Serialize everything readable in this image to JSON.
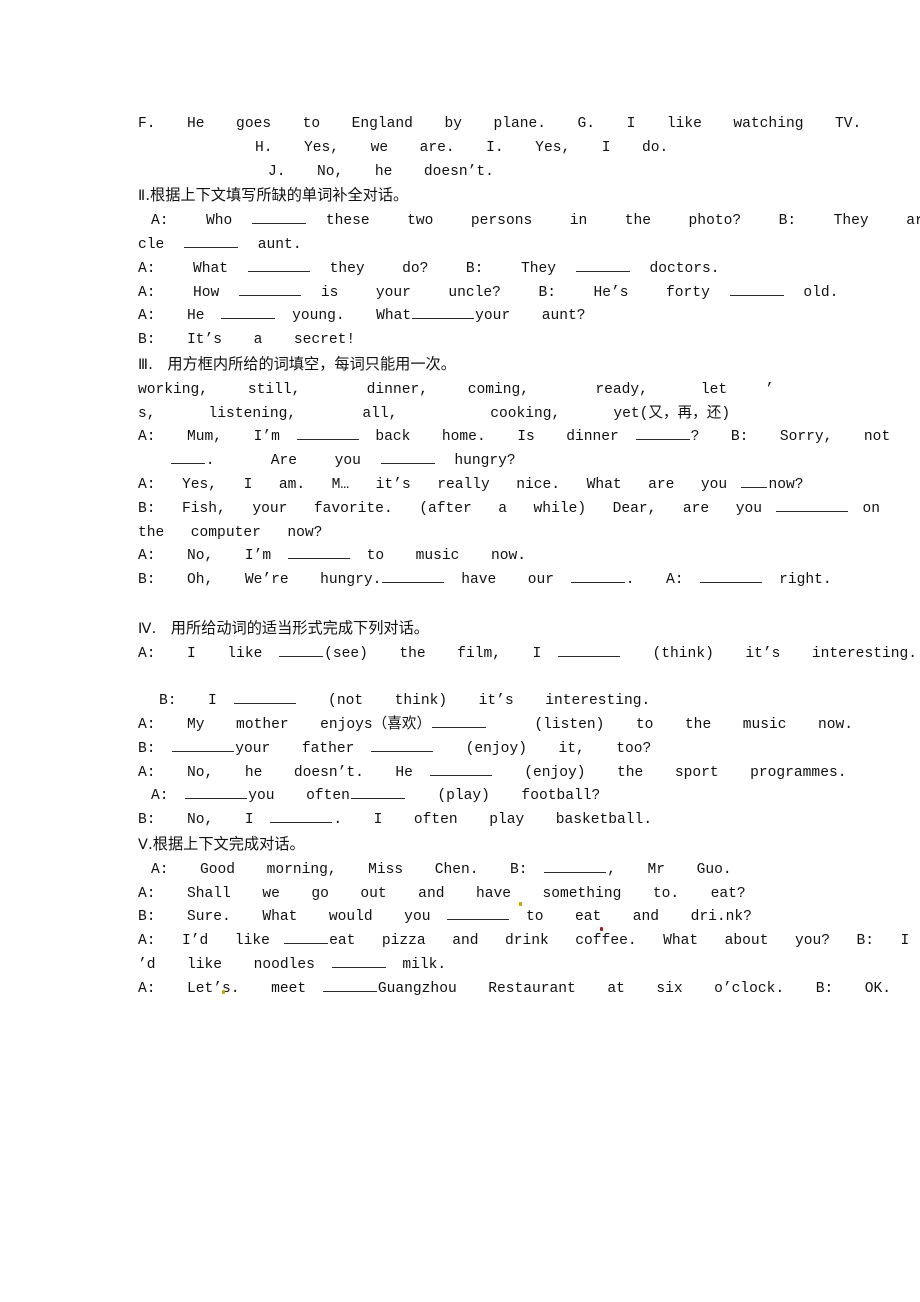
{
  "document": {
    "type": "english-exercise-worksheet",
    "language": "zh-CN/en",
    "page_background": "#ffffff",
    "text_color": "#111111"
  },
  "lines": {
    "l01": "F.  He  goes  to  England  by  plane.  G.  I  like  watching  TV.",
    "l02": "H.  Yes,  we  are.  I.  Yes,  I  do.",
    "l03": "J.  No,  he  doesn’t.",
    "heading_2_numeral": "Ⅱ",
    "heading_2_text": ".根据上下文填写所缺的单词补全对话。",
    "l04a": "A:  Who ",
    "l04b": " these  two  persons  in  the  photo?  B:  They  are  my  un",
    "l05a": "cle ",
    "l05b": " aunt.",
    "l06a": "A:  What ",
    "l06b": " they  do?  B:  They ",
    "l06c": " doctors.",
    "l07a": "A:  How ",
    "l07b": " is  your  uncle?  B:  He’s  forty ",
    "l07c": " old.",
    "l08a": "A:  He ",
    "l08b": " young.  What",
    "l08c": "your  aunt?",
    "l09": "B:  It’s  a  secret!",
    "heading_3_numeral": "Ⅲ",
    "heading_3_text": ".   用方框内所给的词填空，每词只能用一次。",
    "wordbox_line1": "working,   still,     dinner,   coming,     ready,    let",
    "wordbox_line1_trailing": "’",
    "wordbox_line2": "s,    listening,     all,       cooking,    yet(又，再，还)",
    "l10a": "A:  Mum,  I’m ",
    "l10b": " back  home.  Is  dinner ",
    "l10c": "?  B:  Sorry,  not",
    "l11a": " ",
    "l11b": ".   Are  you ",
    "l11c": " hungry?",
    "l12a": "A:  Yes,  I  am.  M…  it’s  really  nice.  What  are  you ",
    "l12b": "now?",
    "l13a": "B:  Fish,  your  favorite.  (after  a  while)  Dear,  are  you ",
    "l13b": " on",
    "l14": "the  computer  now?",
    "l15a": "A:  No,  I’m ",
    "l15b": " to  music  now.",
    "l16a": "B:  Oh,  We’re  hungry.",
    "l16b": " have  our ",
    "l16c": ".  A: ",
    "l16d": " right.",
    "heading_4_numeral": "Ⅳ",
    "heading_4_text": ".   用所给动词的适当形式完成下列对话。",
    "l17a": "A:  I  like ",
    "l17b": "(see)  the  film,  I ",
    "l17c": "  (think)  it’s  interesting.",
    "l18a": "B:  I ",
    "l18b": "  (not  think)  it’s  interesting.",
    "l19a": "A:  My  mother  enjoys（喜欢）",
    "l19b": "   (listen)  to  the  music  now.",
    "l20a": "B: ",
    "l20b": "your  father ",
    "l20c": "  (enjoy)  it,  too?",
    "l21a": "A:  No,  he  doesn’t.  He ",
    "l21b": "  (enjoy)  the  sport  programmes.",
    "l22a": "A: ",
    "l22b": "you  often",
    "l22c": "  (play)  football?",
    "l23a": "B:  No,  I ",
    "l23b": ".  I  often  play  basketball.",
    "heading_5_numeral": "Ⅴ",
    "heading_5_text": ".根据上下文完成对话。",
    "l24a": "A:  Good  morning,  Miss  Chen.  B: ",
    "l24b": ",  Mr  Guo.",
    "l25": "A:  Shall  we  go  out  and  have  something  to.  eat?",
    "l26a": "B:  Sure.  What  would  you ",
    "l26b": " to  eat  and  dri.nk?",
    "l27a": "A:  I’d  like ",
    "l27b": "eat  pizza  and  drink  coffee.  What  about  you?  B:  I",
    "l28a": "’d  like  noodles ",
    "l28b": " milk.",
    "l29a": "A:  Let’s.  meet ",
    "l29b": "Guangzhou  Restaurant  at  six  o’clock.  B:  OK."
  },
  "word_box": {
    "words": [
      "working",
      "still",
      "dinner",
      "coming",
      "ready",
      "let’s",
      "listening",
      "all",
      "cooking",
      "yet(又，再，还)"
    ]
  },
  "sections": [
    {
      "numeral": "Ⅱ",
      "title": "根据上下文填写所缺的单词补全对话。"
    },
    {
      "numeral": "Ⅲ",
      "title": "用方框内所给的词填空，每词只能用一次。"
    },
    {
      "numeral": "Ⅳ",
      "title": "用所给动词的适当形式完成下列对话。"
    },
    {
      "numeral": "Ⅴ",
      "title": "根据上下文完成对话。"
    }
  ]
}
